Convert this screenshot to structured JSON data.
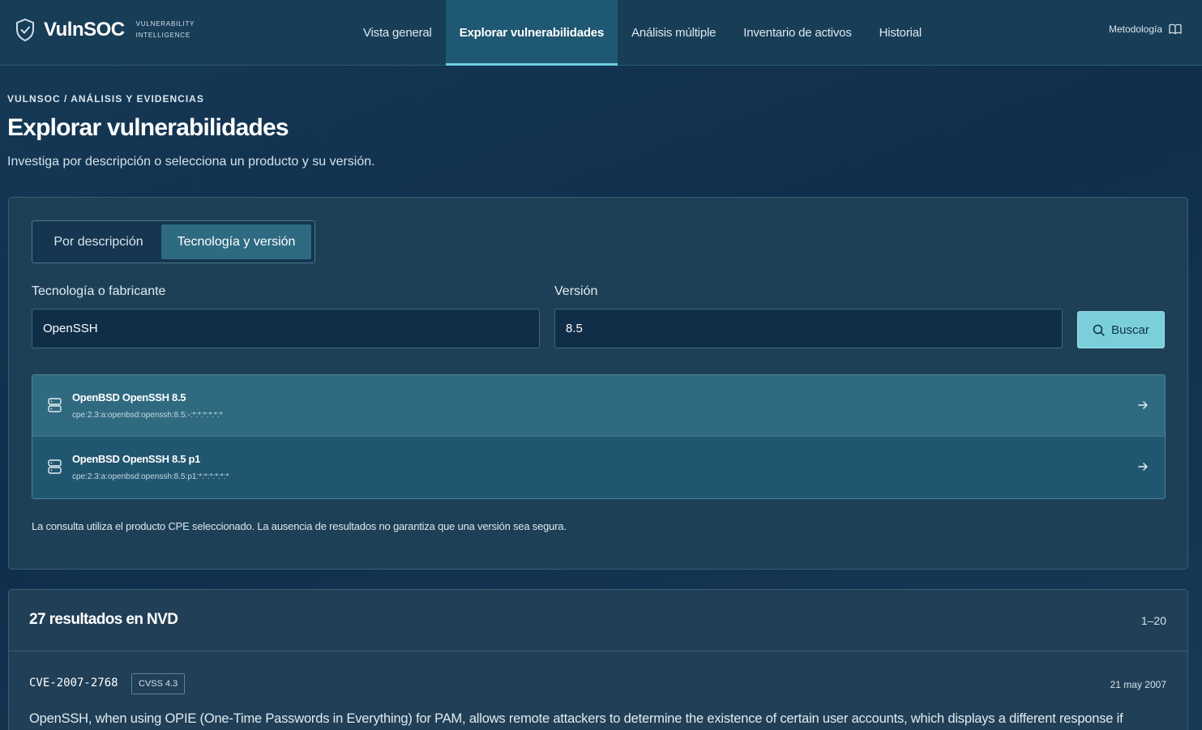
{
  "header": {
    "brand_name": "VulnSOC",
    "brand_sub_1": "VULNERABILITY",
    "brand_sub_2": "INTELLIGENCE",
    "nav": [
      {
        "label": "Vista general"
      },
      {
        "label": "Explorar vulnerabilidades",
        "active": true
      },
      {
        "label": "Análisis múltiple"
      },
      {
        "label": "Inventario de activos"
      },
      {
        "label": "Historial"
      }
    ],
    "methodology_label": "Metodología"
  },
  "page": {
    "breadcrumb": "VULNSOC / ANÁLISIS Y EVIDENCIAS",
    "title": "Explorar vulnerabilidades",
    "subtitle": "Investiga por descripción o selecciona un producto y su versión."
  },
  "search": {
    "tabs": [
      {
        "label": "Por descripción"
      },
      {
        "label": "Tecnología y versión",
        "active": true
      }
    ],
    "tech_label": "Tecnología o fabricante",
    "tech_value": "OpenSSH",
    "version_label": "Versión",
    "version_value": "8.5",
    "search_button": "Buscar",
    "cpe_results": [
      {
        "name": "OpenBSD OpenSSH 8.5",
        "cpe": "cpe:2.3:a:openbsd:openssh:8.5:-:*:*:*:*:*:*"
      },
      {
        "name": "OpenBSD OpenSSH 8.5 p1",
        "cpe": "cpe:2.3:a:openbsd:openssh:8.5:p1:*:*:*:*:*:*"
      }
    ],
    "note": "La consulta utiliza el producto CPE seleccionado. La ausencia de resultados no garantiza que una versión sea segura."
  },
  "results": {
    "title": "27 resultados en NVD",
    "range": "1–20",
    "items": [
      {
        "id": "CVE-2007-2768",
        "cvss": "CVSS 4.3",
        "date": "21 may 2007",
        "description": "OpenSSH, when using OPIE (One-Time Passwords in Everything) for PAM, allows remote attackers to determine the existence of certain user accounts, which displays a different response if"
      }
    ]
  },
  "colors": {
    "accent": "#7bcfdb",
    "nav_active_underline": "#6fd0e0",
    "background": "#102e4b"
  },
  "icons": [
    "shield-icon",
    "book-open-icon",
    "search-icon",
    "database-icon",
    "arrow-right-icon"
  ]
}
